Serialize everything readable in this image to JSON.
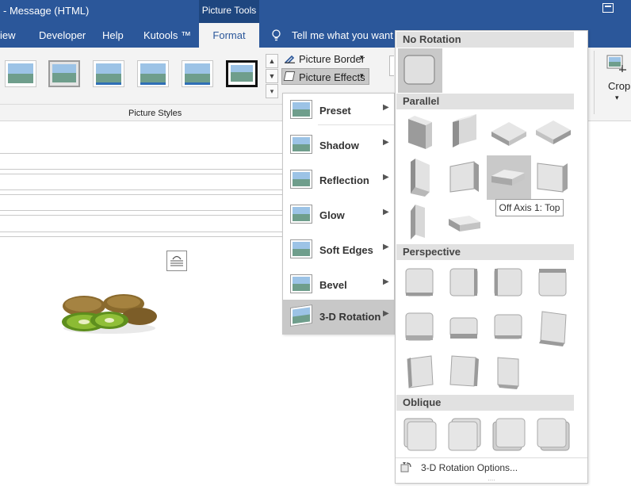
{
  "title_bar": {
    "window_title": "- Message (HTML)",
    "contextual_group": "Picture Tools",
    "restore_icon": "ribbon-display-icon"
  },
  "tabs": [
    {
      "label": "iew"
    },
    {
      "label": "Developer"
    },
    {
      "label": "Help"
    },
    {
      "label": "Kutools ™"
    }
  ],
  "active_tab": "Format",
  "tell_me": "Tell me what you want to",
  "ribbon": {
    "picture_border": "Picture Border",
    "picture_effects": "Picture Effects",
    "group_label": "Picture Styles",
    "crop": "Crop"
  },
  "effects_menu": {
    "items": [
      {
        "label": "Preset"
      },
      {
        "label": "Shadow"
      },
      {
        "label": "Reflection"
      },
      {
        "label": "Glow"
      },
      {
        "label": "Soft Edges"
      },
      {
        "label": "Bevel"
      },
      {
        "label": "3-D Rotation"
      }
    ]
  },
  "rotation_gallery": {
    "no_rotation": "No Rotation",
    "parallel": "Parallel",
    "perspective": "Perspective",
    "oblique": "Oblique",
    "tooltip": "Off Axis 1: Top",
    "options": "3-D Rotation Options..."
  },
  "colors": {
    "brand": "#2b579a",
    "ribbon_bg": "#f3f3f3",
    "selected": "#c9c9c9"
  }
}
